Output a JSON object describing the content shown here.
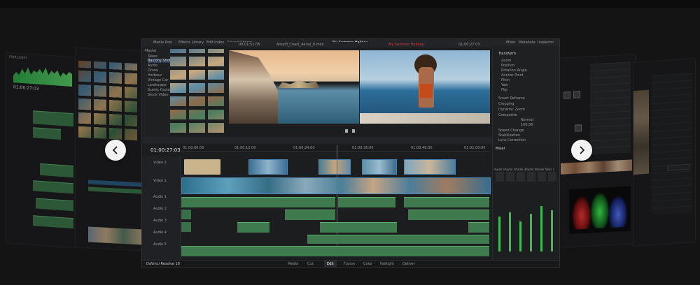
{
  "project_title": "My Summer Holiday",
  "timecode": "01:00:27:03",
  "toolbar": {
    "items": [
      "Media Pool",
      "Effects Library",
      "Edit Index",
      "Sound Library"
    ],
    "right_items": [
      "Mixer",
      "Metadata",
      "Inspector"
    ]
  },
  "media_pool": {
    "title": "Master",
    "bins": [
      "Master",
      "Takes",
      "Balcony Shot",
      "Audio",
      "Drone",
      "Harbour",
      "Vintage Car",
      "Landscape",
      "Scenic Footage",
      "Stock Video"
    ]
  },
  "viewers": {
    "source_name": "Amalfi_Coast_Aerial_8.mov",
    "program_name": "My Summer Holiday",
    "source_tc": "00:01:51:05",
    "program_tc": "01:00:27:03"
  },
  "inspector": {
    "title": "Transform",
    "fields": [
      "Zoom",
      "Position",
      "Rotation Angle",
      "Anchor Point",
      "Pitch",
      "Yaw",
      "Flip"
    ],
    "sections": [
      "Smart Reframe",
      "Cropping",
      "Dynamic Zoom",
      "Composite",
      "Speed Change",
      "Stabilization",
      "Lens Correction"
    ],
    "composite_mode": "Normal",
    "opacity": "100.00"
  },
  "timeline": {
    "video_tracks": [
      {
        "label": "Video 2"
      },
      {
        "label": "Video 1"
      }
    ],
    "audio_tracks": [
      {
        "label": "Audio 1"
      },
      {
        "label": "Audio 2"
      },
      {
        "label": "Audio 3"
      },
      {
        "label": "Audio 4"
      },
      {
        "label": "Audio 5"
      }
    ],
    "ruler_marks": [
      "01:00:00:00",
      "01:00:12:00",
      "01:00:24:00",
      "01:00:36:00",
      "01:00:48:00",
      "01:01:00:00"
    ]
  },
  "mixer": {
    "title": "Mixer",
    "channels": [
      "Audio 1",
      "Audio 2",
      "Audio 3",
      "Audio 4",
      "Audio 5",
      "Bus 1"
    ],
    "levels": [
      0.55,
      0.62,
      0.48,
      0.6,
      0.72,
      0.66
    ]
  },
  "page_tabs": [
    "Media",
    "Cut",
    "Edit",
    "Fusion",
    "Color",
    "Fairlight",
    "Deliver"
  ],
  "active_tab": "Edit",
  "brand": "DaVinci Resolve 18",
  "carousel": {
    "prev_label": "‹",
    "next_label": "›"
  },
  "colors": {
    "accent": "#e0383a",
    "audio": "#3f7a4e",
    "video": "#2c5e86",
    "playhead": "#e0383a"
  }
}
